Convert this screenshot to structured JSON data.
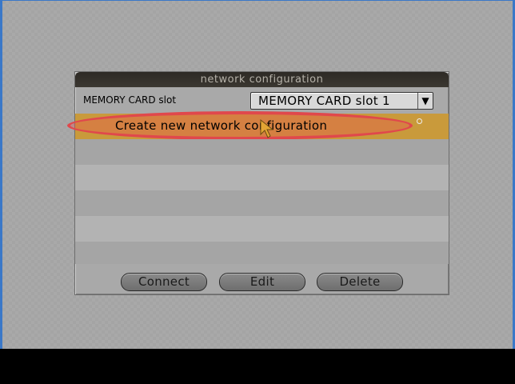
{
  "dialog": {
    "title": "network configuration",
    "slot_label": "MEMORY CARD slot",
    "slot_value": "MEMORY CARD slot 1",
    "dropdown_glyph": "▼"
  },
  "list": {
    "items": [
      {
        "label": "Create new network configuration",
        "selected": true
      }
    ]
  },
  "buttons": {
    "connect": "Connect",
    "edit": "Edit",
    "delete": "Delete"
  },
  "colors": {
    "selection": "#c99a3b",
    "highlight_ring": "#e0484c",
    "title_bar": "#2d2a25",
    "title_text": "#b5b1a8"
  },
  "icons": {
    "pointer": "cursor-arrow-icon",
    "dropdown": "chevron-down-icon",
    "indicator": "circle-indicator-icon"
  }
}
